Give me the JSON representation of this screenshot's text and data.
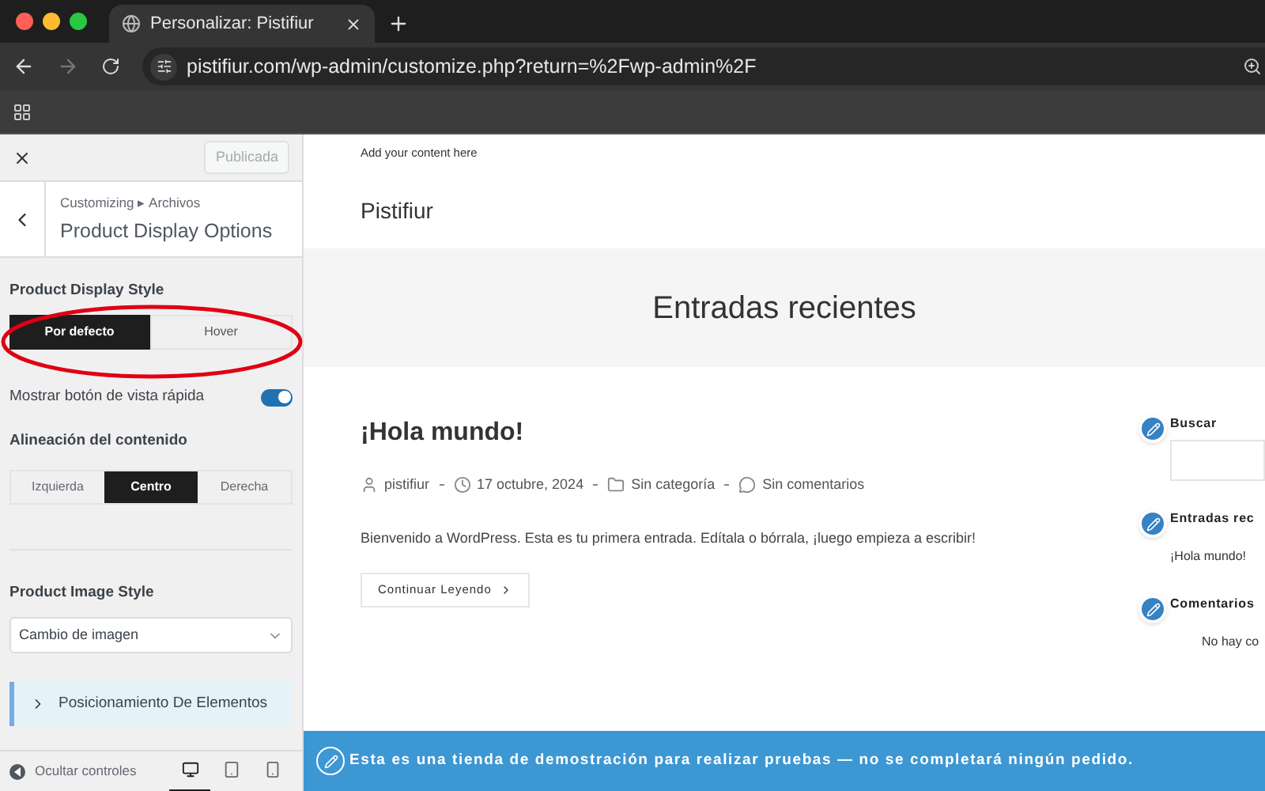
{
  "browser": {
    "tab_title": "Personalizar: Pistifiur",
    "url": "pistifiur.com/wp-admin/customize.php?return=%2Fwp-admin%2F"
  },
  "customizer": {
    "publish_button": "Publicada",
    "breadcrumb": "Customizing ▸ Archivos",
    "panel_title": "Product Display Options",
    "display_style": {
      "label": "Product Display Style",
      "options": [
        {
          "label": "Por defecto",
          "selected": true
        },
        {
          "label": "Hover",
          "selected": false
        }
      ]
    },
    "quick_view": {
      "label": "Mostrar botón de vista rápida",
      "on": true
    },
    "alignment": {
      "label": "Alineación del contenido",
      "options": [
        {
          "label": "Izquierda",
          "selected": false
        },
        {
          "label": "Centro",
          "selected": true
        },
        {
          "label": "Derecha",
          "selected": false
        }
      ]
    },
    "image_style": {
      "label": "Product Image Style",
      "value": "Cambio de imagen"
    },
    "section": {
      "label": "Posicionamiento De Elementos",
      "expanded": false
    },
    "footer": {
      "hide_label": "Ocultar controles",
      "devices": [
        {
          "kind": "desktop",
          "selected": true
        },
        {
          "kind": "tablet",
          "selected": false
        },
        {
          "kind": "mobile",
          "selected": false
        }
      ]
    }
  },
  "preview": {
    "topbar_text": "Add your content here",
    "site_title": "Pistifiur",
    "page_title": "Entradas recientes",
    "post": {
      "title": "¡Hola mundo!",
      "author": "pistifiur",
      "date": "17 octubre, 2024",
      "category": "Sin categoría",
      "comments": "Sin comentarios",
      "excerpt": "Bienvenido a WordPress. Esta es tu primera entrada. Edítala o bórrala, ¡luego empieza a escribir!",
      "read_more": "Continuar Leyendo"
    },
    "widgets": [
      {
        "kind": "search",
        "title": "Buscar"
      },
      {
        "kind": "list",
        "title": "Entradas rec",
        "items": [
          "¡Hola mundo!"
        ]
      },
      {
        "kind": "list",
        "title": "Comentarios",
        "items": [
          "No hay co"
        ]
      }
    ],
    "notice": "Esta es una tienda de demostración para realizar pruebas — no se completará ningún pedido."
  }
}
